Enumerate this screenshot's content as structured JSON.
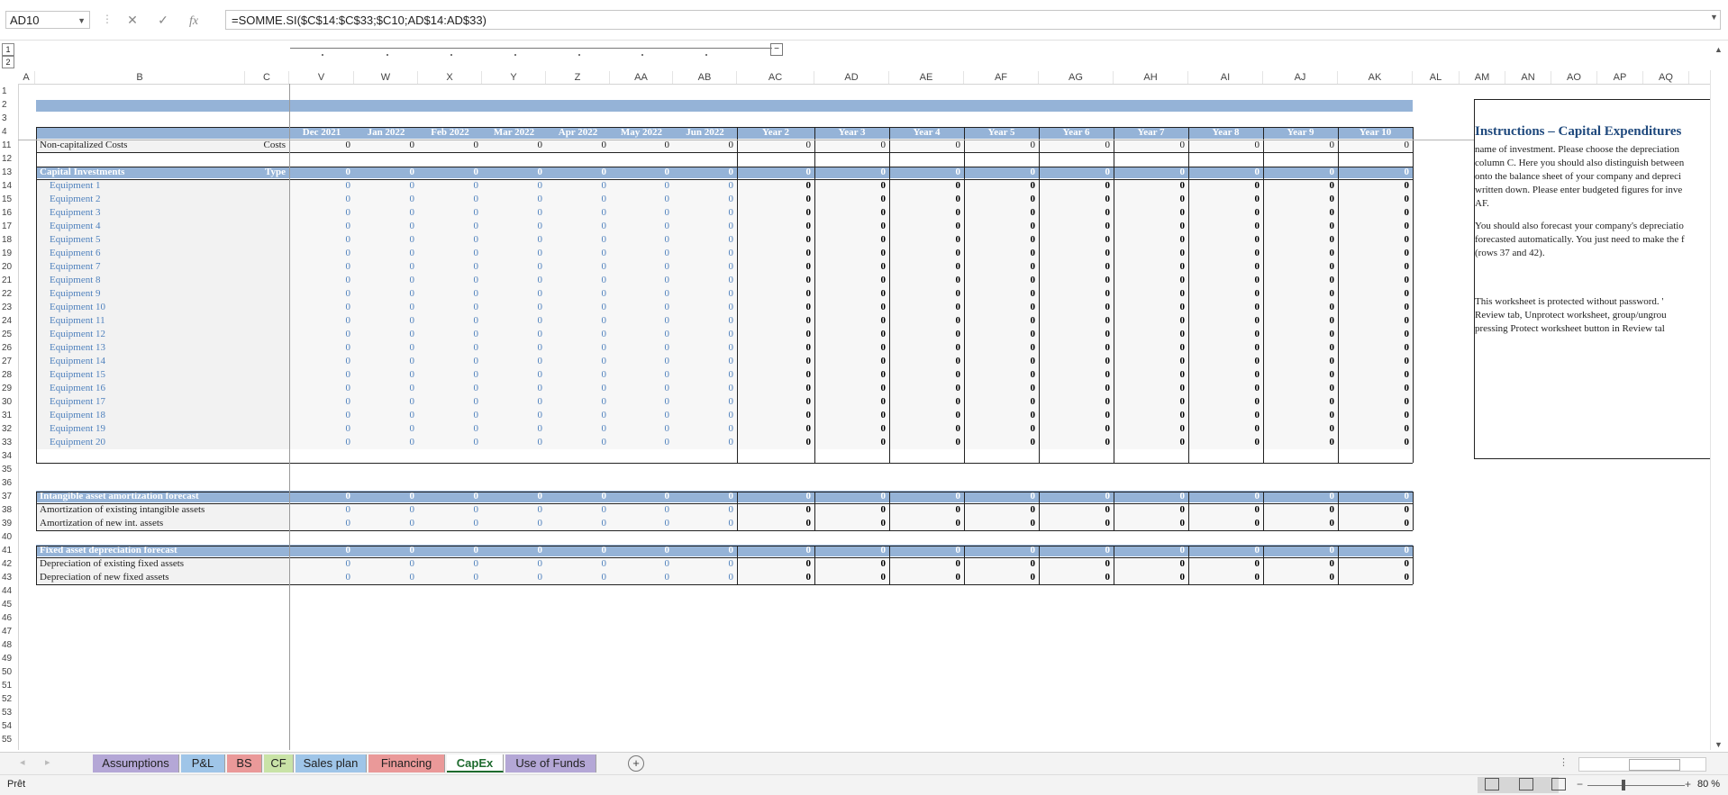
{
  "name_box": "AD10",
  "formula": "=SOMME.SI($C$14:$C$33;$C10;AD$14:AD$33)",
  "fx_buttons": {
    "cancel": "✕",
    "enter": "✓",
    "fx": "fx"
  },
  "columns": [
    "A",
    "B",
    "C",
    "V",
    "W",
    "X",
    "Y",
    "Z",
    "AA",
    "AB",
    "AC",
    "AD",
    "AE",
    "AF",
    "AG",
    "AH",
    "AI",
    "AJ",
    "AK",
    "AL",
    "AM",
    "AN",
    "AO",
    "AP",
    "AQ"
  ],
  "rows": [
    "1",
    "2",
    "3",
    "4",
    "11",
    "12",
    "13",
    "14",
    "15",
    "16",
    "17",
    "18",
    "19",
    "20",
    "21",
    "22",
    "23",
    "24",
    "25",
    "26",
    "27",
    "28",
    "29",
    "30",
    "31",
    "32",
    "33",
    "34",
    "35",
    "36",
    "37",
    "38",
    "39",
    "40",
    "41",
    "42",
    "43",
    "44",
    "45",
    "46",
    "47",
    "48",
    "49",
    "50",
    "51",
    "52",
    "53",
    "54",
    "55"
  ],
  "outline_levels": [
    "1",
    "2"
  ],
  "period_headers": [
    "Dec 2021",
    "Jan 2022",
    "Feb 2022",
    "Mar 2022",
    "Apr 2022",
    "May 2022",
    "Jun 2022",
    "Year 2",
    "Year 3",
    "Year 4",
    "Year 5",
    "Year 6",
    "Year 7",
    "Year 8",
    "Year 9",
    "Year 10"
  ],
  "non_capitalized": {
    "label": "Non-capitalized Costs",
    "type": "Costs"
  },
  "capital_investments": {
    "label": "Capital Investments",
    "type": "Type"
  },
  "equipment": [
    "Equipment 1",
    "Equipment 2",
    "Equipment 3",
    "Equipment 4",
    "Equipment 5",
    "Equipment 6",
    "Equipment 7",
    "Equipment 8",
    "Equipment 9",
    "Equipment 10",
    "Equipment 11",
    "Equipment 12",
    "Equipment 13",
    "Equipment 14",
    "Equipment 15",
    "Equipment 16",
    "Equipment 17",
    "Equipment 18",
    "Equipment 19",
    "Equipment 20"
  ],
  "intangible": {
    "header": "Intangible asset amortization forecast",
    "rows": [
      "Amortization of existing intangible assets",
      "Amortization of new int. assets"
    ]
  },
  "fixed": {
    "header": "Fixed asset depreciation forecast",
    "rows": [
      "Depreciation of existing fixed assets",
      "Depreciation of new fixed assets"
    ]
  },
  "zero_value": "0",
  "instructions": {
    "title": "Instructions – Capital Expenditures",
    "lines": [
      "name of investment. Please choose the depreciation",
      "column C. Here you should also distinguish between",
      "onto the balance sheet of your company and depreci",
      "written down. Please enter budgeted figures for inve",
      "AF.",
      "You should also forecast your company's depreciatio",
      "forecasted automatically. You just need to make the f",
      "(rows 37 and 42).",
      "This worksheet is protected without password. '",
      "Review tab, Unprotect worksheet, group/ungrou",
      "pressing Protect worksheet button in Review tal"
    ]
  },
  "sheet_tabs": [
    {
      "label": "Assumptions",
      "color": "#b4a7d6"
    },
    {
      "label": "P&L",
      "color": "#9fc5e8"
    },
    {
      "label": "BS",
      "color": "#ea9999"
    },
    {
      "label": "CF",
      "color": "#c9e3a7"
    },
    {
      "label": "Sales plan",
      "color": "#9fc5e8"
    },
    {
      "label": "Financing",
      "color": "#ea9999"
    },
    {
      "label": "CapEx",
      "color": "#ffffff"
    },
    {
      "label": "Use of Funds",
      "color": "#b4a7d6"
    }
  ],
  "status": "Prêt",
  "zoom": "80 %"
}
